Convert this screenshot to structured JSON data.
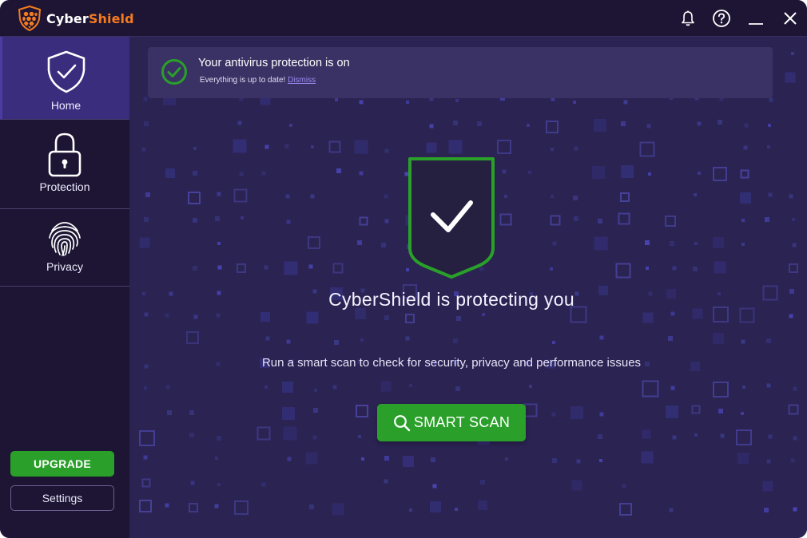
{
  "app": {
    "brand_part1": "Cyber",
    "brand_part2": "Shield",
    "brand_accent_color": "#f47b20",
    "icons": [
      "shield-logo-icon",
      "bell-icon",
      "help-icon",
      "minimize-icon",
      "close-icon"
    ]
  },
  "sidebar": {
    "items": [
      {
        "label": "Home",
        "icon": "shield-check-icon",
        "active": true
      },
      {
        "label": "Protection",
        "icon": "lock-icon",
        "active": false
      },
      {
        "label": "Privacy",
        "icon": "fingerprint-icon",
        "active": false
      }
    ],
    "upgrade_label": "UPGRADE",
    "settings_label": "Settings"
  },
  "banner": {
    "title": "Your antivirus protection is on",
    "subtitle": "Everything is up to date!",
    "dismiss_label": "Dismiss",
    "status_color": "#2aa02a"
  },
  "main": {
    "headline": "CyberShield is protecting you",
    "description": "Run a smart scan to check for security, privacy and performance issues",
    "scan_button_label": "SMART SCAN",
    "accent_color": "#2aa02a"
  }
}
